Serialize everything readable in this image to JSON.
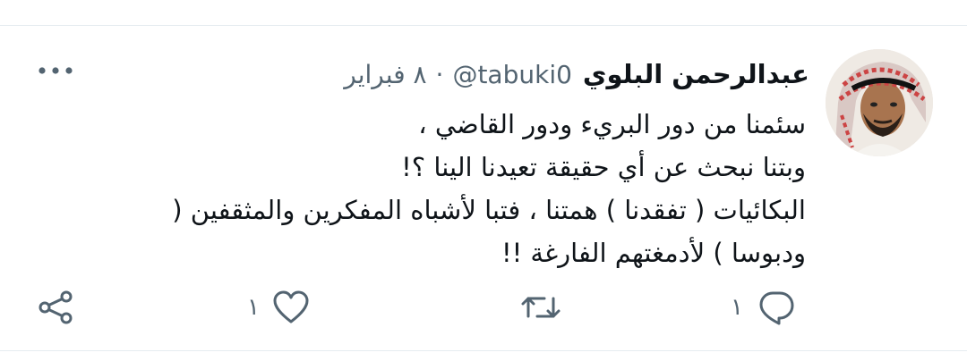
{
  "tweet": {
    "author": {
      "display_name": "عبدالرحمن البلوي",
      "handle": "@tabuki0"
    },
    "separator": "·",
    "date": "٨ فبراير",
    "lines": [
      "سئمنا من دور البريء ودور القاضي ،",
      "وبتنا نبحث عن أي حقيقة تعيدنا الينا ؟!",
      "البكائيات ( تفقدنا ) همتنا ، فتبا لأشباه المفكرين والمثقفين (",
      "ودبوسا ) لأدمغتهم الفارغة !!"
    ],
    "actions": {
      "reply_count": "١",
      "like_count": "١"
    },
    "icons": {
      "more": "more-horizontal-icon",
      "reply": "reply-icon",
      "retweet": "retweet-icon",
      "like": "heart-icon",
      "share": "share-icon"
    }
  },
  "colors": {
    "text": "#0f1419",
    "secondary": "#536471",
    "divider": "#e6ecf0"
  }
}
